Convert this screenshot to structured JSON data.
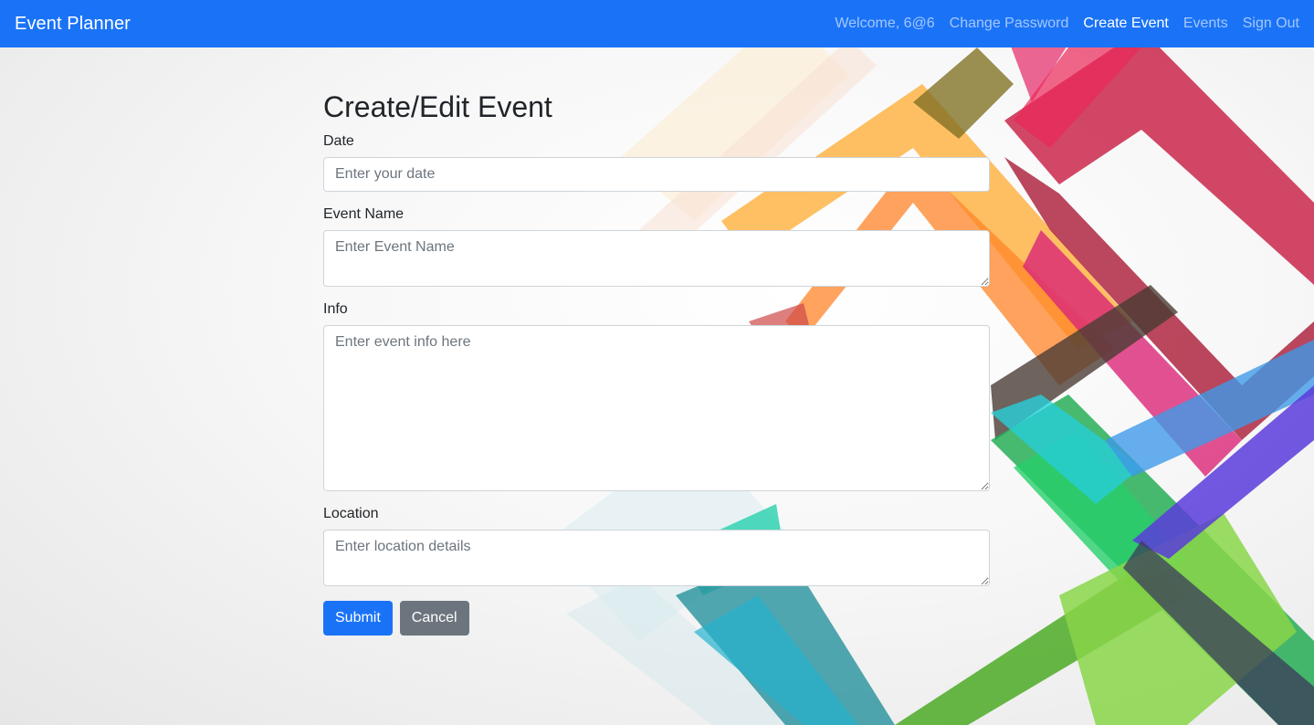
{
  "navbar": {
    "brand": "Event Planner",
    "welcome": "Welcome, 6@6",
    "links": [
      "Change Password",
      "Create Event",
      "Events",
      "Sign Out"
    ],
    "active_link": "Create Event",
    "color": "#1a73f7"
  },
  "form": {
    "title": "Create/Edit Event",
    "date": {
      "label": "Date",
      "placeholder": "Enter your date",
      "value": ""
    },
    "event_name": {
      "label": "Event Name",
      "placeholder": "Enter Event Name",
      "value": ""
    },
    "info": {
      "label": "Info",
      "placeholder": "Enter event info here",
      "value": ""
    },
    "location": {
      "label": "Location",
      "placeholder": "Enter location details",
      "value": ""
    },
    "submit_label": "Submit",
    "cancel_label": "Cancel"
  },
  "colors": {
    "primary": "#1a73f7",
    "secondary": "#6c757d"
  }
}
